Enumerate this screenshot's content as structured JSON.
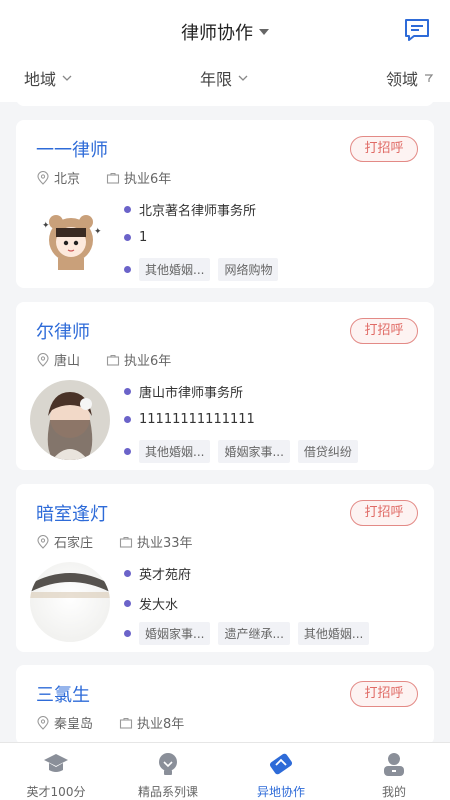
{
  "header": {
    "title": "律师协作"
  },
  "filters": {
    "region": "地域",
    "years": "年限",
    "field": "领域"
  },
  "lawyers": [
    {
      "name": "一一律师",
      "city": "北京",
      "years": "执业6年",
      "firm": "北京著名律师事务所",
      "intro": "1",
      "tags": [
        "其他婚姻...",
        "网络购物"
      ]
    },
    {
      "name": "尔律师",
      "city": "唐山",
      "years": "执业6年",
      "firm": "唐山市律师事务所",
      "intro": "11111111111111",
      "tags": [
        "其他婚姻...",
        "婚姻家事...",
        "借贷纠纷"
      ]
    },
    {
      "name": "暗室逢灯",
      "city": "石家庄",
      "years": "执业33年",
      "firm": "英才苑府",
      "intro": "发大水",
      "tags": [
        "婚姻家事...",
        "遗产继承...",
        "其他婚姻..."
      ]
    },
    {
      "name": "三氯生",
      "city": "秦皇岛",
      "years": "执业8年"
    }
  ],
  "greet_label": "打招呼",
  "tabs": [
    {
      "label": "英才100分",
      "icon": "graduation-cap-icon"
    },
    {
      "label": "精品系列课",
      "icon": "lightbulb-icon"
    },
    {
      "label": "异地协作",
      "icon": "handshake-icon"
    },
    {
      "label": "我的",
      "icon": "person-icon"
    }
  ],
  "colors": {
    "accent": "#2e6bd8",
    "greet": "#e06b66",
    "dot": "#6b63c9"
  }
}
